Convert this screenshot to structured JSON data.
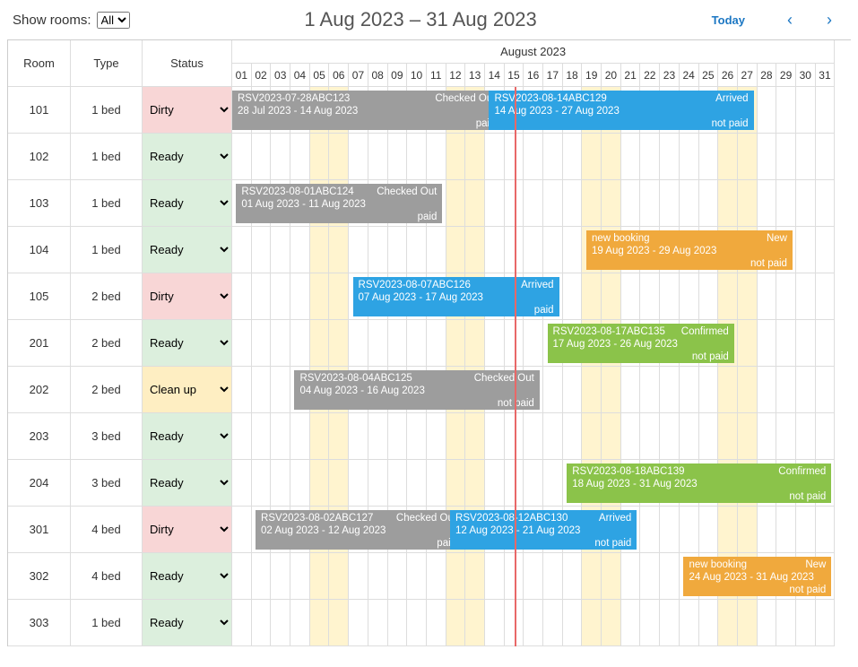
{
  "filter": {
    "label": "Show rooms:",
    "options": [
      "All"
    ],
    "selected": "All"
  },
  "title": "1 Aug 2023 – 31 Aug 2023",
  "today_label": "Today",
  "month_label": "August 2023",
  "columns": {
    "room": "Room",
    "type": "Type",
    "status": "Status"
  },
  "days": [
    "01",
    "02",
    "03",
    "04",
    "05",
    "06",
    "07",
    "08",
    "09",
    "10",
    "11",
    "12",
    "13",
    "14",
    "15",
    "16",
    "17",
    "18",
    "19",
    "20",
    "21",
    "22",
    "23",
    "24",
    "25",
    "26",
    "27",
    "28",
    "29",
    "30",
    "31"
  ],
  "weekend_days": [
    5,
    6,
    12,
    13,
    19,
    20,
    26,
    27
  ],
  "today_day": 15,
  "status_options": [
    "Ready",
    "Dirty",
    "Clean up"
  ],
  "rooms": [
    {
      "room": "101",
      "type": "1 bed",
      "status": "Dirty"
    },
    {
      "room": "102",
      "type": "1 bed",
      "status": "Ready"
    },
    {
      "room": "103",
      "type": "1 bed",
      "status": "Ready"
    },
    {
      "room": "104",
      "type": "1 bed",
      "status": "Ready"
    },
    {
      "room": "105",
      "type": "2 bed",
      "status": "Dirty"
    },
    {
      "room": "201",
      "type": "2 bed",
      "status": "Ready"
    },
    {
      "room": "202",
      "type": "2 bed",
      "status": "Clean up"
    },
    {
      "room": "203",
      "type": "3 bed",
      "status": "Ready"
    },
    {
      "room": "204",
      "type": "3 bed",
      "status": "Ready"
    },
    {
      "room": "301",
      "type": "4 bed",
      "status": "Dirty"
    },
    {
      "room": "302",
      "type": "4 bed",
      "status": "Ready"
    },
    {
      "room": "303",
      "type": "1 bed",
      "status": "Ready"
    }
  ],
  "bookings": [
    {
      "row": 0,
      "start": -3,
      "end": 14,
      "color": "gray",
      "ref": "RSV2023-07-28ABC123",
      "dates": "28 Jul 2023 - 14 Aug 2023",
      "status": "Checked Out",
      "paid": "paid"
    },
    {
      "row": 0,
      "start": 14,
      "end": 27,
      "color": "blue",
      "ref": "RSV2023-08-14ABC129",
      "dates": "14 Aug 2023 - 27 Aug 2023",
      "status": "Arrived",
      "paid": "not paid"
    },
    {
      "row": 2,
      "start": 1,
      "end": 11,
      "color": "gray",
      "ref": "RSV2023-08-01ABC124",
      "dates": "01 Aug 2023 - 11 Aug 2023",
      "status": "Checked Out",
      "paid": "paid"
    },
    {
      "row": 3,
      "start": 19,
      "end": 29,
      "color": "orange",
      "ref": "new booking",
      "dates": "19 Aug 2023 - 29 Aug 2023",
      "status": "New",
      "paid": "not paid"
    },
    {
      "row": 4,
      "start": 7,
      "end": 17,
      "color": "blue",
      "ref": "RSV2023-08-07ABC126",
      "dates": "07 Aug 2023 - 17 Aug 2023",
      "status": "Arrived",
      "paid": "paid"
    },
    {
      "row": 5,
      "start": 17,
      "end": 26,
      "color": "green",
      "ref": "RSV2023-08-17ABC135",
      "dates": "17 Aug 2023 - 26 Aug 2023",
      "status": "Confirmed",
      "paid": "not paid"
    },
    {
      "row": 6,
      "start": 4,
      "end": 16,
      "color": "gray",
      "ref": "RSV2023-08-04ABC125",
      "dates": "04 Aug 2023 - 16 Aug 2023",
      "status": "Checked Out",
      "paid": "not paid"
    },
    {
      "row": 8,
      "start": 18,
      "end": 31,
      "color": "green",
      "ref": "RSV2023-08-18ABC139",
      "dates": "18 Aug 2023 - 31 Aug 2023",
      "status": "Confirmed",
      "paid": "not paid"
    },
    {
      "row": 9,
      "start": 2,
      "end": 12,
      "color": "gray",
      "ref": "RSV2023-08-02ABC127",
      "dates": "02 Aug 2023 - 12 Aug 2023",
      "status": "Checked Out",
      "paid": "paid"
    },
    {
      "row": 9,
      "start": 12,
      "end": 21,
      "color": "blue",
      "ref": "RSV2023-08-12ABC130",
      "dates": "12 Aug 2023 - 21 Aug 2023",
      "status": "Arrived",
      "paid": "not paid"
    },
    {
      "row": 10,
      "start": 24,
      "end": 31,
      "color": "orange",
      "ref": "new booking",
      "dates": "24 Aug 2023 - 31 Aug 2023",
      "status": "New",
      "paid": "not paid"
    }
  ]
}
